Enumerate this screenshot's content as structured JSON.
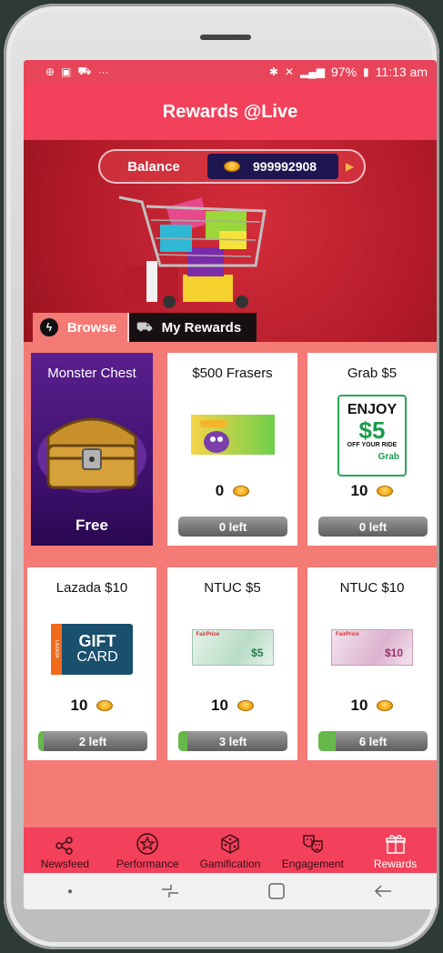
{
  "status_bar": {
    "battery": "97%",
    "time": "11:13 am"
  },
  "app_title": "Rewards @Live",
  "balance": {
    "label": "Balance",
    "value": "999992908"
  },
  "tabs": [
    {
      "label": "Browse",
      "icon": "lightning-icon"
    },
    {
      "label": "My Rewards",
      "icon": "cart-icon"
    }
  ],
  "rewards": [
    {
      "title": "Monster Chest",
      "badge": "Free"
    },
    {
      "title": "$500 Frasers",
      "price": "0",
      "stock": "0 left",
      "stock_level": 0
    },
    {
      "title": "Grab $5",
      "price": "10",
      "stock": "0 left",
      "stock_level": 0
    },
    {
      "title": "Lazada $10",
      "price": "10",
      "stock": "2 left",
      "stock_level": 0.05
    },
    {
      "title": "NTUC $5",
      "price": "10",
      "stock": "3 left",
      "stock_level": 0.08
    },
    {
      "title": "NTUC $10",
      "price": "10",
      "stock": "6 left",
      "stock_level": 0.16
    }
  ],
  "grab_card": {
    "line1": "ENJOY",
    "line2": "$5",
    "line3": "OFF YOUR RIDE",
    "brand": "Grab"
  },
  "lazada_card": {
    "line1": "GIFT",
    "line2": "CARD",
    "brand": "LAZADA"
  },
  "ntuc_card": {
    "brand": "FairPrice",
    "amount_5": "$5",
    "amount_10": "$10"
  },
  "bottom_nav": [
    {
      "label": "Newsfeed",
      "icon": "share-icon"
    },
    {
      "label": "Performance",
      "icon": "star-icon"
    },
    {
      "label": "Gamification",
      "icon": "dice-icon"
    },
    {
      "label": "Engagement",
      "icon": "masks-icon"
    },
    {
      "label": "Rewards",
      "icon": "gift-icon"
    }
  ],
  "colors": {
    "primary": "#f3405b",
    "background": "#f47a76",
    "balance_box": "#1e1650",
    "coin": "#f2a91a",
    "stock_fill": "#67b84a"
  }
}
